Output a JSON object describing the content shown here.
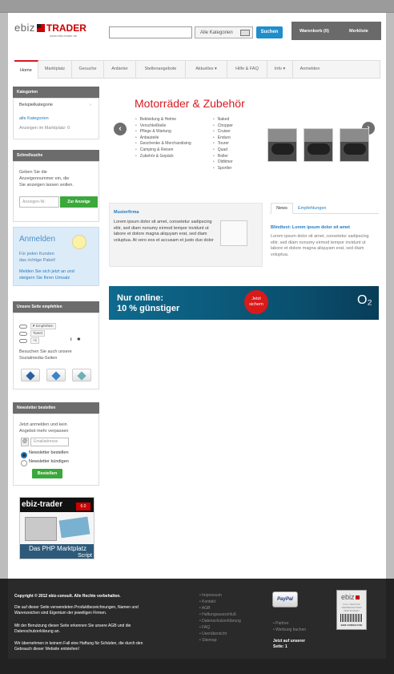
{
  "header": {
    "logo_ebiz": "ebiz",
    "logo_trader": "TRADER",
    "logo_sub": "www.ebiz-trader.de",
    "category_select": "Alle Kategorien",
    "search_button": "Suchen",
    "cart": "Warenkorb (0)",
    "wishlist": "Merkliste"
  },
  "nav": {
    "items": [
      "Home",
      "Marktplatz",
      "Gesuche",
      "Anbieter",
      "Stellenangebote",
      "Aktuelles ▾",
      "Hilfe & FAQ",
      "Info ▾",
      "Anmelden"
    ]
  },
  "sidebar": {
    "categories": {
      "title": "Kategorien",
      "example": "Beispielkategorie",
      "all": "alle Kategorien",
      "count": "Anzeigen im Marktplatz: 0"
    },
    "quicksearch": {
      "title": "Schnellsuche",
      "text": [
        "Geben Sie die",
        "Anzeigennummer ein, die",
        "Sie anzeigen lassen wollen."
      ],
      "placeholder": "Anzeigen-Nr.",
      "button": "Zur Anzeige"
    },
    "login": {
      "title": "Anmelden",
      "text1": [
        "Für jeden Kunden",
        "das richtige Paket!"
      ],
      "text2": [
        "Melden Sie sich jetzt an und",
        "steigern Sie Ihren Umsatz"
      ]
    },
    "social": {
      "title": "Unsere Seite empfehlen",
      "like": "Empfehlen",
      "tweet": "Tweet",
      "plus": "+1",
      "text": [
        "Besuchen Sie auch unsere",
        "Sozialmedia-Seiten"
      ]
    },
    "newsletter": {
      "title": "Newsletter bestellen",
      "text": [
        "Jetzt anmelden und kein",
        "Angebot mehr verpassen"
      ],
      "placeholder": "Emailadresse",
      "subscribe": "Newsletter bestellen",
      "unsubscribe": "Newsletter kündigen",
      "button": "Bestellen"
    },
    "ad": {
      "title": "ebiz-trader",
      "version": "6.0",
      "tagline": [
        "Das PHP Marktplatz",
        "Script"
      ]
    }
  },
  "main": {
    "category_title": "Motorräder & Zubehör",
    "list_left": [
      "Bekleidung & Helme",
      "Verschleißteile",
      "Pflege & Wartung",
      "Anbauteile",
      "Geschenke & Merchandising",
      "Camping & Reisen",
      "Zubehör & Gepäck"
    ],
    "list_right": [
      "Naked",
      "Chopper",
      "Cruiser",
      "Enduro",
      "Tourer",
      "Quad",
      "Roller",
      "Oldtimer",
      "Sportler"
    ],
    "prev": "‹",
    "next": "›",
    "firm": {
      "title": "Musterfirma",
      "text": "Lorem ipsum dolor sit amet, consetetur sadipscing elitr, sed diam nonumy eirmod tempor invidunt ut labore et dolore magna aliquyam erat, sed diam voluptua. At vero eos et accusam et justo duo dolor"
    },
    "tabs": [
      "News",
      "Empfehlungen"
    ],
    "news": {
      "title": "Blindtext: Lorem ipsum dolor sit amet",
      "text": "Lorem ipsum dolor sit amet, consetetur sadipscing elitr, sed diam nonumy eirmod tempor invidunt ut labore et dolore magna aliquyam erat, sed diam voluptua."
    },
    "banner": {
      "line1": "Nur online:",
      "line2": "10 % günstiger",
      "badge": [
        "Jetzt",
        "sichern"
      ],
      "brand": "O₂"
    }
  },
  "footer": {
    "copyright": "Copyright © 2012 ebiz-consult. Alle Rechte vorbehalten.",
    "p1": [
      "Die auf dieser Seite verwendeten Produktbezeichnungen, Namen und",
      "Warenzeichen sind Eigentum der jeweiligen Firmen."
    ],
    "p2": [
      "Mit der Benutzung dieser Seite erkennen Sie unsere AGB und die",
      "Datenschutzerklärung an."
    ],
    "p3": [
      "Wir übernehmen in keinem Fall eine Haftung für Schäden, die durch den",
      "Gebrauch dieser Website entstehen!"
    ],
    "links1": [
      "Impressum",
      "Kontakt",
      "AGB",
      "Haftungsausschluß",
      "Datenschutzerklärung",
      "FAQ",
      "Userübersicht",
      "Sitemap"
    ],
    "paypal": "PayPal",
    "links2": [
      "Partner",
      "Werbung buchen"
    ],
    "online": [
      "Jetzt auf unserer",
      "Seite: 1"
    ],
    "seal_brand": "ebiz",
    "seal_lines": [
      "FULL SERVICE",
      "WERBEPARTNER",
      "ZERTIFIZIERT"
    ],
    "seal_bottom": "EBIZ-CONSULT.DE"
  },
  "colors": {
    "accent": "#d71a21",
    "link": "#1f7bc1",
    "button_green": "#3aa83a",
    "button_blue": "#1f8ecb"
  }
}
